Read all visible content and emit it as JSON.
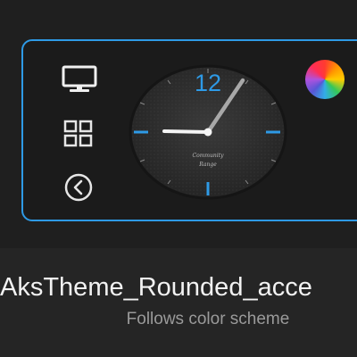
{
  "theme": {
    "name": "AksTheme_Rounded_acce",
    "subtitle": "Follows color scheme",
    "accent_color": "#2e9ae6"
  },
  "preview": {
    "icons": [
      "monitor-icon",
      "grid-icon",
      "back-circle-icon"
    ],
    "clock": {
      "numeral_12": "12",
      "brand_line_1": "Community",
      "brand_line_2": "Range",
      "time_shown": "9:05"
    },
    "color_swatch": "rainbow"
  }
}
